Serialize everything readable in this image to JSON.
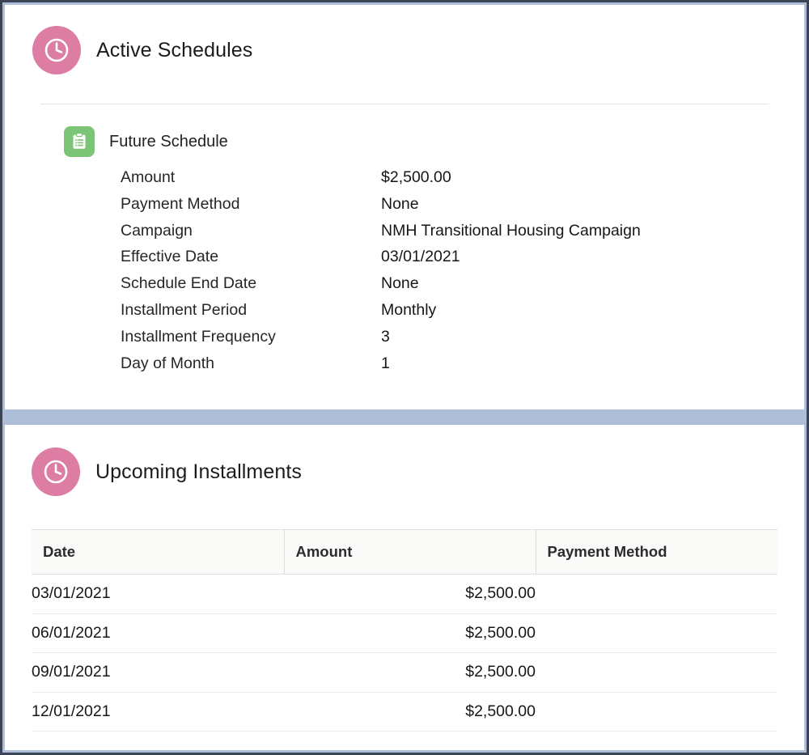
{
  "theme": {
    "accent_pink": "#dd7da3",
    "accent_green": "#7cc576",
    "frame_border": "#3b4455",
    "gap_band": "#aebdd8",
    "table_header_bg": "#fafaf8"
  },
  "active_schedules": {
    "icon": "clock-icon",
    "title": "Active Schedules",
    "schedule": {
      "icon": "clipboard-list-icon",
      "heading": "Future Schedule",
      "fields": [
        {
          "label": "Amount",
          "value": "$2,500.00"
        },
        {
          "label": "Payment Method",
          "value": "None"
        },
        {
          "label": "Campaign",
          "value": "NMH Transitional Housing Campaign"
        },
        {
          "label": "Effective Date",
          "value": "03/01/2021"
        },
        {
          "label": "Schedule End Date",
          "value": "None"
        },
        {
          "label": "Installment Period",
          "value": "Monthly"
        },
        {
          "label": "Installment Frequency",
          "value": "3"
        },
        {
          "label": "Day of Month",
          "value": "1"
        }
      ]
    }
  },
  "upcoming_installments": {
    "icon": "clock-icon",
    "title": "Upcoming Installments",
    "table": {
      "columns": [
        "Date",
        "Amount",
        "Payment Method"
      ],
      "rows": [
        {
          "date": "03/01/2021",
          "amount": "$2,500.00",
          "payment_method": ""
        },
        {
          "date": "06/01/2021",
          "amount": "$2,500.00",
          "payment_method": ""
        },
        {
          "date": "09/01/2021",
          "amount": "$2,500.00",
          "payment_method": ""
        },
        {
          "date": "12/01/2021",
          "amount": "$2,500.00",
          "payment_method": ""
        }
      ]
    }
  }
}
